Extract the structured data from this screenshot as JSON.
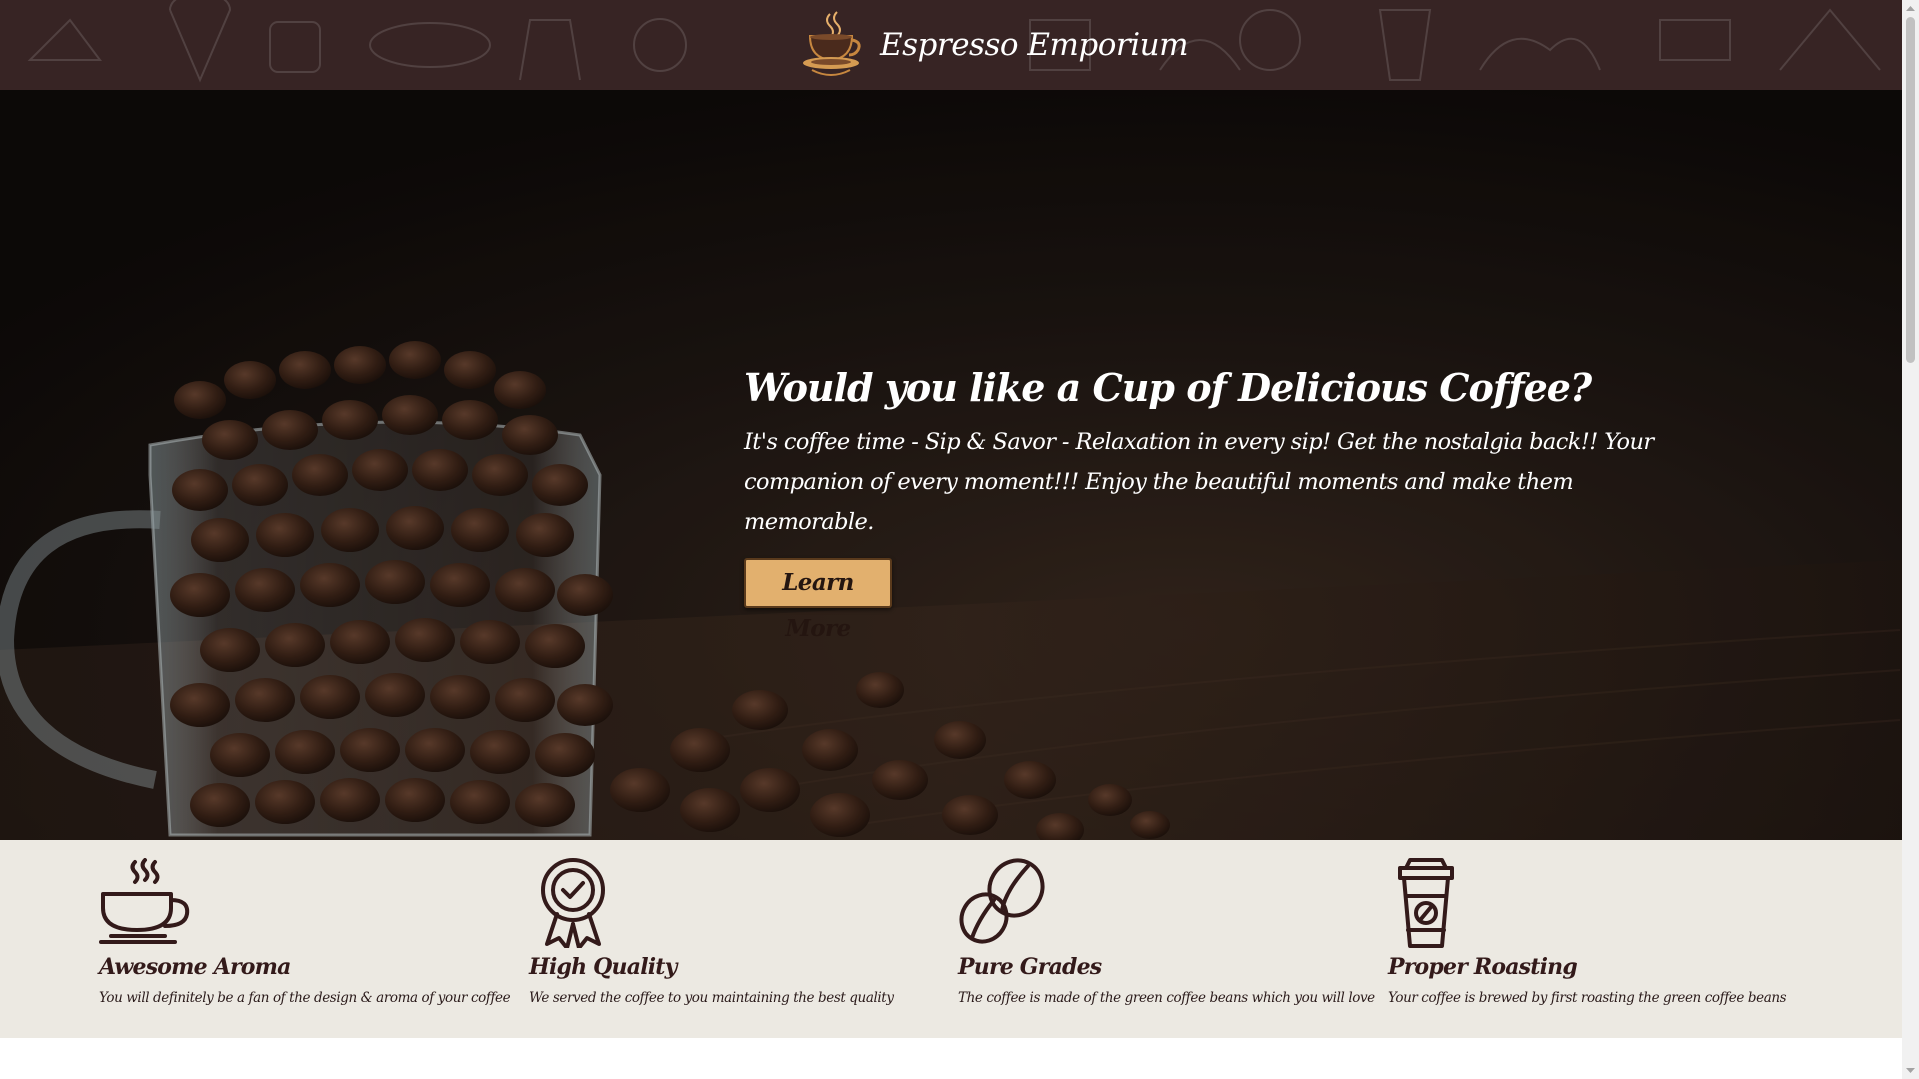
{
  "header": {
    "brand_name": "Espresso Emporium",
    "logo_icon": "coffee-cup-logo-icon",
    "background_color": "#372424"
  },
  "hero": {
    "title": "Would you like a Cup of Delicious Coffee?",
    "text": "It's coffee time - Sip & Savor - Relaxation in every sip! Get the nostalgia back!! Your companion of every moment!!! Enjoy the beautiful moments and make them memorable.",
    "button_label": "Learn More",
    "button_color": "#e2b06e",
    "background_image": "coffee-beans-in-glass-mug"
  },
  "features": {
    "background_color": "#ece9e2",
    "items": [
      {
        "icon": "steaming-cup-icon",
        "title": "Awesome Aroma",
        "description": "You will definitely be a fan of the design & aroma of your coffee"
      },
      {
        "icon": "quality-badge-icon",
        "title": "High Quality",
        "description": "We served the coffee to you maintaining the best quality"
      },
      {
        "icon": "coffee-beans-icon",
        "title": "Pure Grades",
        "description": "The coffee is made of the green coffee beans which you will love"
      },
      {
        "icon": "takeaway-cup-icon",
        "title": "Proper Roasting",
        "description": "Your coffee is brewed by first roasting the green coffee beans"
      }
    ]
  },
  "scrollbar": {
    "scroll_position": 0
  }
}
